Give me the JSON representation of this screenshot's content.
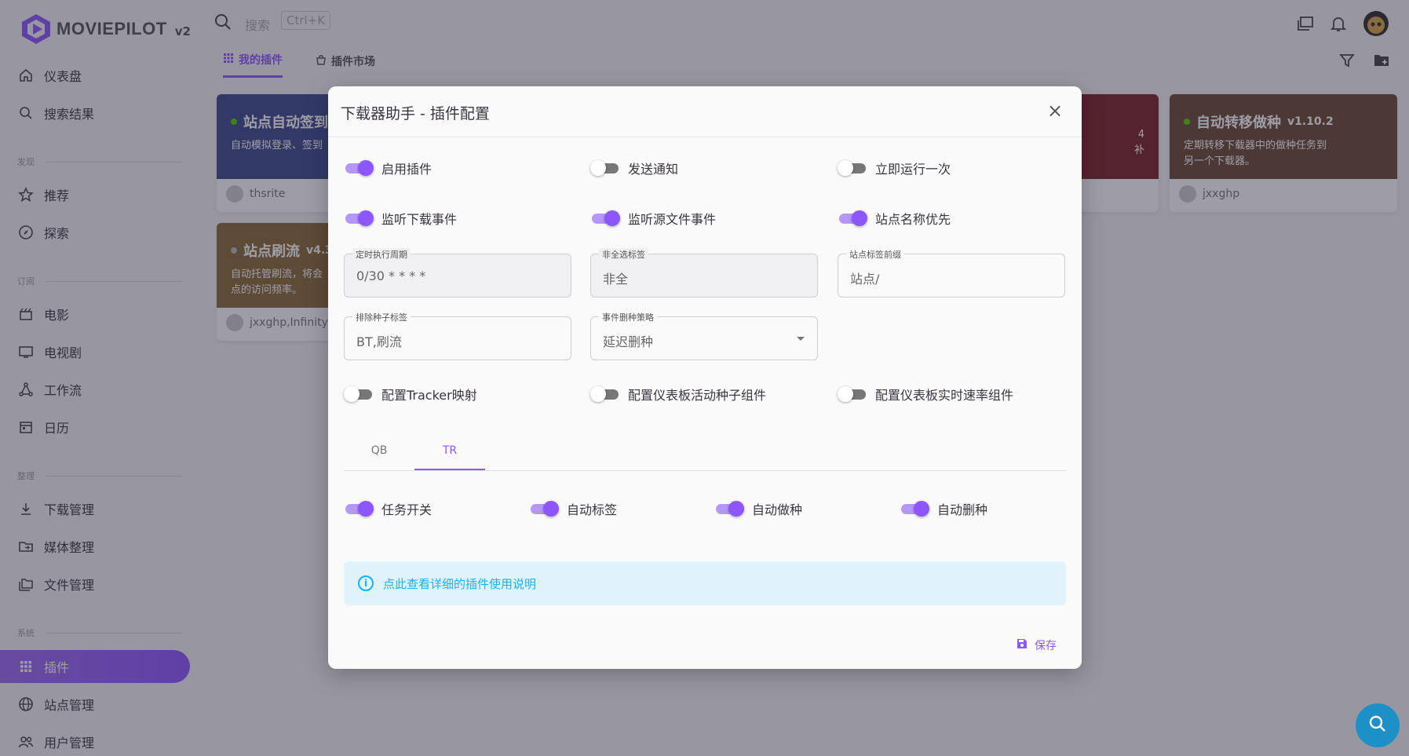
{
  "app": {
    "name": "MOVIEPILOT",
    "version": "v2"
  },
  "search": {
    "placeholder": "搜索",
    "shortcut": "Ctrl+K"
  },
  "sidebar": {
    "items": [
      {
        "label": "仪表盘"
      },
      {
        "label": "搜索结果"
      },
      {
        "section": "发现"
      },
      {
        "label": "推荐"
      },
      {
        "label": "探索"
      },
      {
        "section": "订阅"
      },
      {
        "label": "电影"
      },
      {
        "label": "电视剧"
      },
      {
        "label": "工作流"
      },
      {
        "label": "日历"
      },
      {
        "section": "整理"
      },
      {
        "label": "下载管理"
      },
      {
        "label": "媒体整理"
      },
      {
        "label": "文件管理"
      },
      {
        "section": "系统"
      },
      {
        "label": "插件",
        "active": true
      },
      {
        "label": "站点管理"
      },
      {
        "label": "用户管理"
      }
    ]
  },
  "tabs": [
    {
      "label": "我的插件",
      "active": true
    },
    {
      "label": "插件市场"
    }
  ],
  "cards": [
    {
      "title": "站点自动签到",
      "desc": "自动模拟登录、签到",
      "author": "thsrite",
      "color": "#3b4a8c"
    },
    {
      "title": "站点刷流",
      "version": "v4.3",
      "desc1": "自动托管刷流，将会",
      "desc2": "点的访问频率。",
      "author": "jxxghp,InfinityF",
      "color": "#8a6a35"
    },
    {
      "title": "自动转移做种",
      "version": "v1.10.2",
      "desc1": "定期转移下载器中的做种任务到",
      "desc2": "另一个下载器。",
      "author": "jxxghp",
      "color": "#6b4a33"
    },
    {
      "desc1": "4",
      "desc2": "补",
      "color": "#7a2228"
    }
  ],
  "dialog": {
    "title": "下载器助手 - 插件配置",
    "switches_row1": [
      {
        "label": "启用插件",
        "on": true
      },
      {
        "label": "发送通知",
        "on": false
      },
      {
        "label": "立即运行一次",
        "on": false
      }
    ],
    "switches_row2": [
      {
        "label": "监听下载事件",
        "on": true
      },
      {
        "label": "监听源文件事件",
        "on": true
      },
      {
        "label": "站点名称优先",
        "on": true
      }
    ],
    "fields": [
      {
        "label": "定时执行周期",
        "value": "0/30 * * * *"
      },
      {
        "label": "非全选标签",
        "value": "非全"
      },
      {
        "label": "站点标签前缀",
        "value": "站点/"
      },
      {
        "label": "排除种子标签",
        "value": "BT,刷流"
      },
      {
        "label": "事件删种策略",
        "value": "延迟删种"
      }
    ],
    "switches_row3": [
      {
        "label": "配置Tracker映射",
        "on": false
      },
      {
        "label": "配置仪表板活动种子组件",
        "on": false
      },
      {
        "label": "配置仪表板实时速率组件",
        "on": false
      }
    ],
    "sub_tabs": [
      {
        "label": "QB"
      },
      {
        "label": "TR",
        "active": true
      }
    ],
    "task_switches": [
      {
        "label": "任务开关",
        "on": true
      },
      {
        "label": "自动标签",
        "on": true
      },
      {
        "label": "自动做种",
        "on": true
      },
      {
        "label": "自动删种",
        "on": true
      }
    ],
    "info_text": "点此查看详细的插件使用说明",
    "save_label": "保存"
  },
  "colors": {
    "primary": "#8c57ff",
    "info": "#16b1ff"
  }
}
